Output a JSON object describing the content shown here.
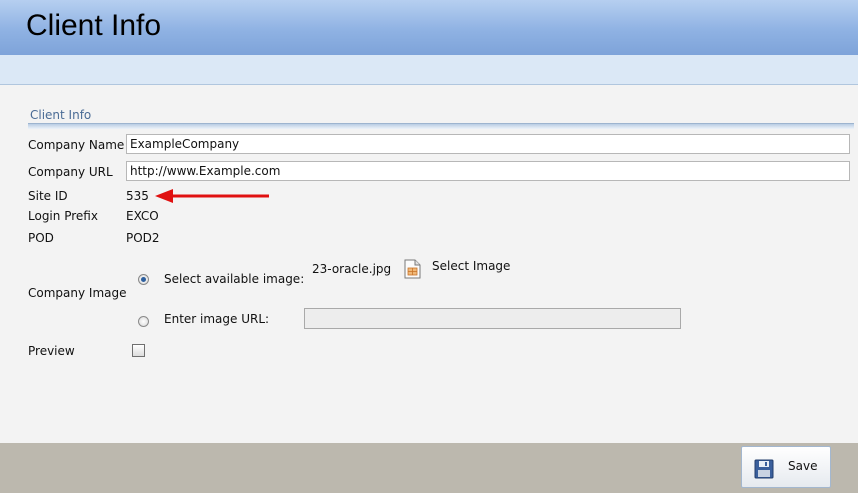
{
  "header": {
    "title": "Client Info"
  },
  "section": {
    "title": "Client Info"
  },
  "fields": {
    "company_name": {
      "label": "Company Name",
      "value": "ExampleCompany"
    },
    "company_url": {
      "label": "Company URL",
      "value": "http://www.Example.com"
    },
    "site_id": {
      "label": "Site ID",
      "value": "535"
    },
    "login_prefix": {
      "label": "Login Prefix",
      "value": "EXCO"
    },
    "pod": {
      "label": "POD",
      "value": "POD2"
    }
  },
  "company_image": {
    "label": "Company Image",
    "option_available": "Select available image:",
    "selected_file": "23-oracle.jpg",
    "select_image_link": "Select Image",
    "option_url": "Enter image URL:",
    "url_value": "",
    "selected_option": "available"
  },
  "preview": {
    "label": "Preview",
    "checked": false
  },
  "footer": {
    "save_label": "Save"
  },
  "colors": {
    "header_gradient_top": "#b6cff0",
    "header_gradient_bottom": "#7ea3d9",
    "annotation_arrow": "#e01010",
    "footer_bg": "#bcb8ae"
  },
  "icons": {
    "select_image": "image-file-icon",
    "save": "floppy-disk-icon"
  }
}
